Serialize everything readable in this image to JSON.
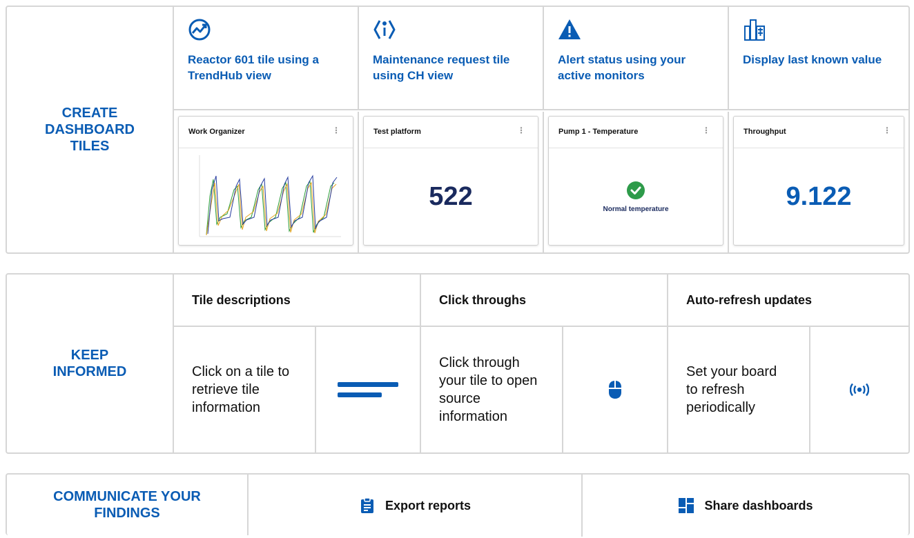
{
  "sections": {
    "create": {
      "label": "CREATE DASHBOARD TILES",
      "features": [
        {
          "icon": "trend-chart-icon",
          "title": "Reactor 601 tile using a TrendHub view"
        },
        {
          "icon": "info-diamond-icon",
          "title": "Maintenance request tile using CH view"
        },
        {
          "icon": "warning-triangle-icon",
          "title": "Alert status using your active monitors"
        },
        {
          "icon": "buildings-icon",
          "title": "Display last known value"
        }
      ],
      "tiles": [
        {
          "title": "Work Organizer",
          "menu": "⋮"
        },
        {
          "title": "Test platform",
          "menu": "⋮",
          "value": "522"
        },
        {
          "title": "Pump 1 - Temperature",
          "menu": "⋮",
          "status": "Normal temperature"
        },
        {
          "title": "Throughput",
          "menu": "⋮",
          "value": "9.122"
        }
      ]
    },
    "keep": {
      "label": "KEEP INFORMED",
      "columns": [
        {
          "header": "Tile descriptions",
          "text": "Click on a tile to retrieve tile information",
          "icon": "text-lines-icon"
        },
        {
          "header": "Click throughs",
          "text": "Click through your tile to open source information",
          "icon": "mouse-icon"
        },
        {
          "header": "Auto-refresh updates",
          "text": "Set your board to refresh periodically",
          "icon": "broadcast-icon"
        }
      ]
    },
    "communicate": {
      "label": "COMMUNICATE YOUR FINDINGS",
      "actions": [
        {
          "label": "Export reports",
          "icon": "clipboard-icon"
        },
        {
          "label": "Share dashboards",
          "icon": "dashboard-icon"
        }
      ]
    }
  },
  "colors": {
    "accent": "#0a5cb4",
    "navy": "#1a2a5e",
    "success": "#2e9b4a",
    "border": "#d6d6d6"
  }
}
